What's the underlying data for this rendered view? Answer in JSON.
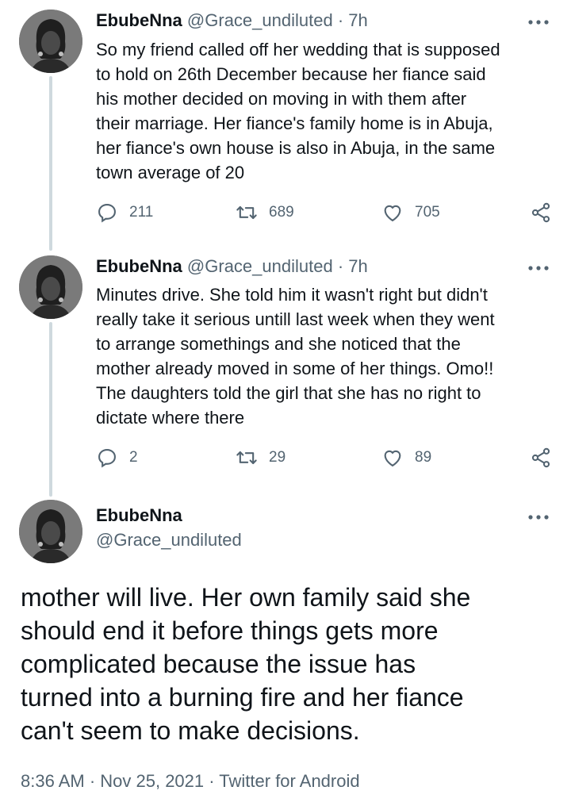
{
  "tweets": [
    {
      "name": "EbubeNna",
      "handle": "@Grace_undiluted",
      "separator": "·",
      "time": "7h",
      "lines": [
        "So my friend called off her wedding that is supposed",
        "to hold on 26th December because her fiance said",
        "his  mother decided on moving in with them after",
        "their marriage. Her fiance's family home is in Abuja,",
        "her fiance's own house is also in Abuja, in the same",
        "town average of 20"
      ],
      "replies": "211",
      "retweets": "689",
      "likes": "705"
    },
    {
      "name": "EbubeNna",
      "handle": "@Grace_undiluted",
      "separator": "·",
      "time": "7h",
      "lines": [
        "Minutes drive. She told him it wasn't right but didn't",
        "really take it serious untill last week when they went",
        "to arrange somethings and she noticed that the",
        "mother already moved in some of her things. Omo!!",
        "The daughters told the girl that she has no right to",
        "dictate where there"
      ],
      "replies": "2",
      "retweets": "29",
      "likes": "89"
    }
  ],
  "main_tweet": {
    "name": "EbubeNna",
    "handle": "@Grace_undiluted",
    "lines": [
      "mother will live. Her own family said she",
      "should end it before things gets more",
      "complicated because the issue has",
      "turned into a burning fire and her fiance",
      "can't seem to make decisions."
    ],
    "timestamp": "8:36 AM · Nov 25, 2021 · Twitter for Android"
  },
  "icons": {
    "more": "more-horizontal-icon",
    "reply": "reply-icon",
    "retweet": "retweet-icon",
    "like": "heart-icon",
    "share": "share-icon"
  },
  "colors": {
    "text": "#0f1419",
    "secondary": "#536471",
    "thread_line": "#cfd9de"
  }
}
